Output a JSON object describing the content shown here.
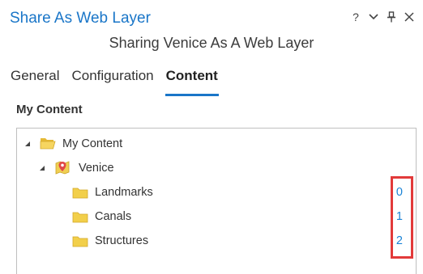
{
  "window": {
    "title": "Share As Web Layer",
    "subtitle": "Sharing Venice As A Web Layer",
    "controls": [
      {
        "name": "help-icon",
        "glyph": "?"
      },
      {
        "name": "chevron-down-icon"
      },
      {
        "name": "pin-icon"
      },
      {
        "name": "close-icon"
      }
    ]
  },
  "tabs": [
    {
      "label": "General",
      "active": false
    },
    {
      "label": "Configuration",
      "active": false
    },
    {
      "label": "Content",
      "active": true
    }
  ],
  "section": {
    "label": "My Content"
  },
  "tree": {
    "root": {
      "label": "My Content",
      "expanded": true,
      "icon": "open-folder-icon"
    },
    "map": {
      "label": "Venice",
      "expanded": true,
      "icon": "map-icon"
    },
    "layers": [
      {
        "label": "Landmarks",
        "count": "0",
        "icon": "folder-icon"
      },
      {
        "label": "Canals",
        "count": "1",
        "icon": "folder-icon"
      },
      {
        "label": "Structures",
        "count": "2",
        "icon": "folder-icon"
      }
    ]
  },
  "colors": {
    "accent": "#1a76c8",
    "highlight": "#e23a3a",
    "folder": "#f2cf4a"
  }
}
